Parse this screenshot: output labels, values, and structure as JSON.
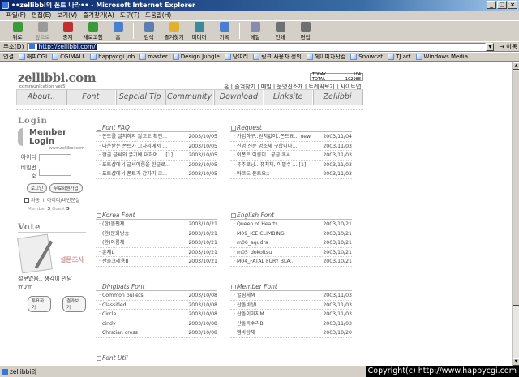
{
  "window": {
    "title": "••zellibbi의 폰트 나라•• - Microsoft Internet Explorer"
  },
  "menu": [
    "파일(F)",
    "편집(E)",
    "보기(V)",
    "즐겨찾기(A)",
    "도구(T)",
    "도움말(H)"
  ],
  "toolbar": [
    {
      "label": "뒤로",
      "icon": "back-icon",
      "color": "#3a9a3a"
    },
    {
      "label": "앞으로",
      "icon": "forward-icon",
      "color": "#9a9a9a",
      "disabled": true
    },
    {
      "label": "중지",
      "icon": "stop-icon",
      "color": "#c03030"
    },
    {
      "label": "새로고침",
      "icon": "refresh-icon",
      "color": "#3a9a3a"
    },
    {
      "label": "홈",
      "icon": "home-icon",
      "color": "#4a7fd0"
    },
    {
      "label": "검색",
      "icon": "search-icon",
      "color": "#5a7fb0"
    },
    {
      "label": "즐겨찾기",
      "icon": "favorites-icon",
      "color": "#e0b030"
    },
    {
      "label": "미디어",
      "icon": "media-icon",
      "color": "#3a8a9a"
    },
    {
      "label": "기록",
      "icon": "history-icon",
      "color": "#4a7fd0"
    },
    {
      "label": "메일",
      "icon": "mail-icon",
      "color": "#8a8ab0"
    },
    {
      "label": "인쇄",
      "icon": "print-icon",
      "color": "#707070"
    },
    {
      "label": "편집",
      "icon": "edit-icon",
      "color": "#707070"
    }
  ],
  "address": {
    "label": "주소(D)",
    "url": "http://zellibbi.com/",
    "go": "이동"
  },
  "links": {
    "label": "연결",
    "items": [
      "해피CGI",
      "CGIMALL",
      "happycgi.job",
      "master",
      "Design Jungle",
      "당여리",
      "링크 사용자 정의",
      "헤이미자닷컴",
      "Snowcat",
      "TJ art",
      "Windows Media"
    ]
  },
  "site": {
    "logo": "zellibbi.com",
    "logo_sub": "communication ver5",
    "counter": [
      {
        "k": "TODAY",
        "v": "104"
      },
      {
        "k": "TOTAL",
        "v": "102988"
      }
    ],
    "toplinks": "홈 | 즐겨찾기 | 메일 | 운영진소개 | 트레픽보기 | 사이트맵",
    "nav": [
      "About..",
      "Font",
      "Sepcial Tip",
      "Community",
      "Download",
      "Linksite",
      "Zellibbi"
    ],
    "login": {
      "header": "Login",
      "title": "Member Login",
      "url": "www.zellibbi.com",
      "id_label": "아이디",
      "pw_label": "비밀번호",
      "login_btn": "로그인",
      "join_btn": "무료회원가입",
      "auto": "자동 ↑ 아이디/비번분실",
      "member_label": "Member",
      "member_count": "3",
      "guest_label": "Guest",
      "guest_count": "5"
    },
    "vote": {
      "header": "Vote",
      "img_text": "설문조사",
      "question": "설문없음.. 생각이 안남",
      "question2": "ㅠ0ㅠ",
      "vote_btn": "투표하기",
      "result_btn": "결과보기"
    },
    "boxes": [
      {
        "title": "Font FAQ",
        "items": [
          {
            "t": "폰트를 설치하지 않고도 확인...",
            "d": "2003/10/05"
          },
          {
            "t": "다운받는 폰트가 그자리에서 ...",
            "d": "2003/10/05"
          },
          {
            "t": "한글 글씨의 굵기에 대하여.... [1]",
            "d": "2003/10/05"
          },
          {
            "t": "포토샵에서 글씨이름을 한글로...",
            "d": "2003/10/05"
          },
          {
            "t": "포토샵에서 폰트가 갑자기 크...",
            "d": "2003/10/05"
          }
        ]
      },
      {
        "title": "Request",
        "items": [
          {
            "t": "가입하구..원치없이..폰트요... new",
            "d": "2003/11/04"
          },
          {
            "t": "신명 신문 명조체 구합니다....",
            "d": "2003/11/03"
          },
          {
            "t": "이폰트 이름이...궁금 혹시 ...",
            "d": "2003/11/03"
          },
          {
            "t": "퓨추로닝...퓨쳐체, 이필수 ... [1]",
            "d": "2003/11/03"
          },
          {
            "t": "바코드 폰트요;;",
            "d": "2003/11/03"
          }
        ]
      },
      {
        "title": "Korea Font",
        "items": [
          {
            "t": "(한)볼펜체",
            "d": "2003/10/21"
          },
          {
            "t": "(한)문화방송",
            "d": "2003/10/21"
          },
          {
            "t": "(한)아름체",
            "d": "2003/10/21"
          },
          {
            "t": "훈체L",
            "d": "2003/10/21"
          },
          {
            "t": "산돌크레용B",
            "d": "2003/10/21"
          }
        ]
      },
      {
        "title": "English Font",
        "items": [
          {
            "t": "Queen of Hearts",
            "d": "2003/10/21"
          },
          {
            "t": "M09_ICE CLIMBING",
            "d": "2003/10/21"
          },
          {
            "t": "m06_aqudra",
            "d": "2003/10/21"
          },
          {
            "t": "m05_dokoitsu",
            "d": "2003/10/21"
          },
          {
            "t": "M04_FATAL FURY BLA...",
            "d": "2003/10/21"
          }
        ]
      },
      {
        "title": "Dingbats Font",
        "items": [
          {
            "t": "Common bullets",
            "d": "2003/10/08"
          },
          {
            "t": "Classified",
            "d": "2003/10/08"
          },
          {
            "t": "Circle",
            "d": "2003/10/08"
          },
          {
            "t": "cindy",
            "d": "2003/10/08"
          },
          {
            "t": "Chrstian cross",
            "d": "2003/10/08"
          }
        ]
      },
      {
        "title": "Member Font",
        "items": [
          {
            "t": "굴림체M",
            "d": "2003/11/03"
          },
          {
            "t": "산돌비상L",
            "d": "2003/11/03"
          },
          {
            "t": "산돌이미지M",
            "d": "2003/11/03"
          },
          {
            "t": "산돌독수리B",
            "d": "2003/11/03"
          },
          {
            "t": "엽바탕체",
            "d": "2003/10/20"
          }
        ]
      },
      {
        "title": "Font Util",
        "items": []
      }
    ]
  },
  "status": "zellibbi의",
  "copyright": "Copyright(c) http://www.happycgi.com"
}
